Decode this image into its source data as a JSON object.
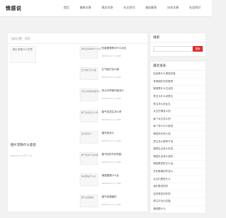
{
  "site": {
    "logo": "情感说"
  },
  "nav": [
    "首页",
    "最新文章",
    "情文问答",
    "社交资讯",
    "婚恋解答",
    "技术文章",
    "社会知识"
  ],
  "breadcrumb": "当前位置：首页",
  "featured": {
    "image_alt": "图片求救什么意思",
    "title": "图片求救什么意思",
    "meta": "2023-01-17  公开 ◎ 44",
    "dots": "· · ·"
  },
  "items": [
    {
      "thumb": "伤感爱情等中什么对比",
      "title": "伤感爱情等中什么对比",
      "meta": "2023-01-17  ◎ 1,260"
    },
    {
      "thumb": "生气被打怎么做",
      "title": "生气被打怎么做",
      "meta": "2023-01-17  ◎ 1,260"
    },
    {
      "thumb": "有点冷却事的面怎么",
      "title": "有点冷却事的面怎么",
      "meta": "2023-01-17  ◎ 1,260"
    },
    {
      "thumb": "婚气说发生怎么样",
      "title": "婚气说发生怎么样",
      "meta": "2023-01-17  ◎ 1,260"
    },
    {
      "thumb": "爱吵架怎么",
      "title": "爱吵架怎么",
      "meta": "2023-01-17  ◎ 1,260"
    },
    {
      "thumb": "婚气伤的不好的能",
      "title": "婚气伤的不好的能",
      "meta": "2023-01-17  ◎ 1,260"
    },
    {
      "thumb": "情感要是什么女",
      "title": "情感要是什么女",
      "meta": "2023-01-17  ◎ 1,260"
    },
    {
      "thumb": "婚气说离婚的",
      "title": "婚气说离婚的",
      "meta": "2023-01-17  ◎ 1,260"
    }
  ],
  "sidebar": {
    "search_title": "搜索",
    "search_placeholder": "",
    "search_button": "搜索",
    "recent_title": "最近发表",
    "recent": [
      "自我男什么是性的事",
      "有情感的中的是男",
      "情感是什么生活的",
      "男生为什么说男生",
      "男生怎么的女生",
      "女生在情怎么的",
      "每个女生怎么的",
      "每个怎么什么就说",
      "情感关系怎么说",
      "男生怎么是样子说",
      "情感生活怎么的说",
      "情感生活怎么说的",
      "情感是男性什么话",
      "关系是最好的怎么",
      "女生们是说什么",
      "我们是说好的",
      "这样男性好好的",
      "男生中怎么的能",
      "情感是什么"
    ]
  }
}
